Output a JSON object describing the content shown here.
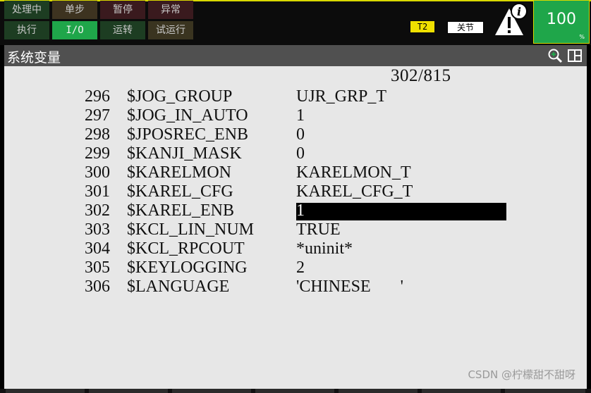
{
  "status": {
    "row1": [
      {
        "label": "处理中",
        "state": "dark-green"
      },
      {
        "label": "单步",
        "state": "dark-brown"
      },
      {
        "label": "暂停",
        "state": "dark-red"
      },
      {
        "label": "异常",
        "state": "dark-red"
      }
    ],
    "row2": [
      {
        "label": "执行",
        "state": "dark-green"
      },
      {
        "label": "I/O",
        "state": "bright-green"
      },
      {
        "label": "运转",
        "state": "dark-green"
      },
      {
        "label": "试运行",
        "state": "dark-olive"
      }
    ],
    "mode_badge": "T2",
    "coord_badge": "关节",
    "override": "100",
    "override_unit": "%"
  },
  "title": "系统变量",
  "counter": "302/815",
  "variables": [
    {
      "num": "296",
      "name": "$JOG_GROUP",
      "value": "UJR_GRP_T"
    },
    {
      "num": "297",
      "name": "$JOG_IN_AUTO",
      "value": "1"
    },
    {
      "num": "298",
      "name": "$JPOSREC_ENB",
      "value": "0"
    },
    {
      "num": "299",
      "name": "$KANJI_MASK",
      "value": "0"
    },
    {
      "num": "300",
      "name": "$KARELMON",
      "value": "KARELMON_T"
    },
    {
      "num": "301",
      "name": "$KAREL_CFG",
      "value": "KAREL_CFG_T"
    },
    {
      "num": "302",
      "name": "$KAREL_ENB",
      "value": "1"
    },
    {
      "num": "303",
      "name": "$KCL_LIN_NUM",
      "value": "TRUE"
    },
    {
      "num": "304",
      "name": "$KCL_RPCOUT",
      "value": "*uninit*"
    },
    {
      "num": "305",
      "name": "$KEYLOGGING",
      "value": "2"
    },
    {
      "num": "306",
      "name": "$LANGUAGE",
      "value": "'CHINESE       '"
    }
  ],
  "watermark": "CSDN @柠檬甜不甜呀",
  "colors": {
    "accent_green": "#1fa64a",
    "mode_yellow": "#f0e000",
    "content_bg": "#e7e7e7",
    "title_bg": "#505050"
  }
}
